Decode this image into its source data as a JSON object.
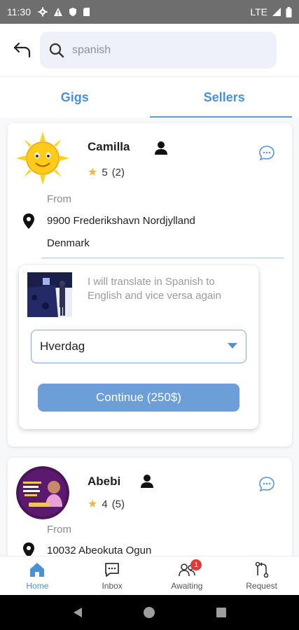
{
  "status_bar": {
    "time": "11:30",
    "network": "LTE"
  },
  "search": {
    "value": "spanish"
  },
  "tabs": [
    {
      "label": "Gigs",
      "active": false
    },
    {
      "label": "Sellers",
      "active": true
    }
  ],
  "sellers": [
    {
      "name": "Camilla",
      "rating": "5",
      "reviews": "(2)",
      "from_label": "From",
      "location_line1": "9900 Frederikshavn  Nordjylland",
      "location_line2": "Denmark",
      "gig": {
        "description": "I will translate in Spanish to English and vice versa again",
        "selected_option": "Hverdag",
        "continue_label": "Continue (250$)"
      }
    },
    {
      "name": "Abebi",
      "rating": "4",
      "reviews": "(5)",
      "from_label": "From",
      "location_line1": "10032 Abeokuta Ogun"
    }
  ],
  "bottom_nav": [
    {
      "label": "Home",
      "icon": "home-icon",
      "active": true
    },
    {
      "label": "Inbox",
      "icon": "inbox-icon",
      "active": false
    },
    {
      "label": "Awaiting",
      "icon": "awaiting-icon",
      "badge": "1",
      "active": false
    },
    {
      "label": "Request",
      "icon": "request-icon",
      "active": false
    }
  ],
  "colors": {
    "accent": "#4b90d6",
    "button": "#6c9ed8",
    "star": "#f2b544",
    "badge": "#e53935"
  }
}
